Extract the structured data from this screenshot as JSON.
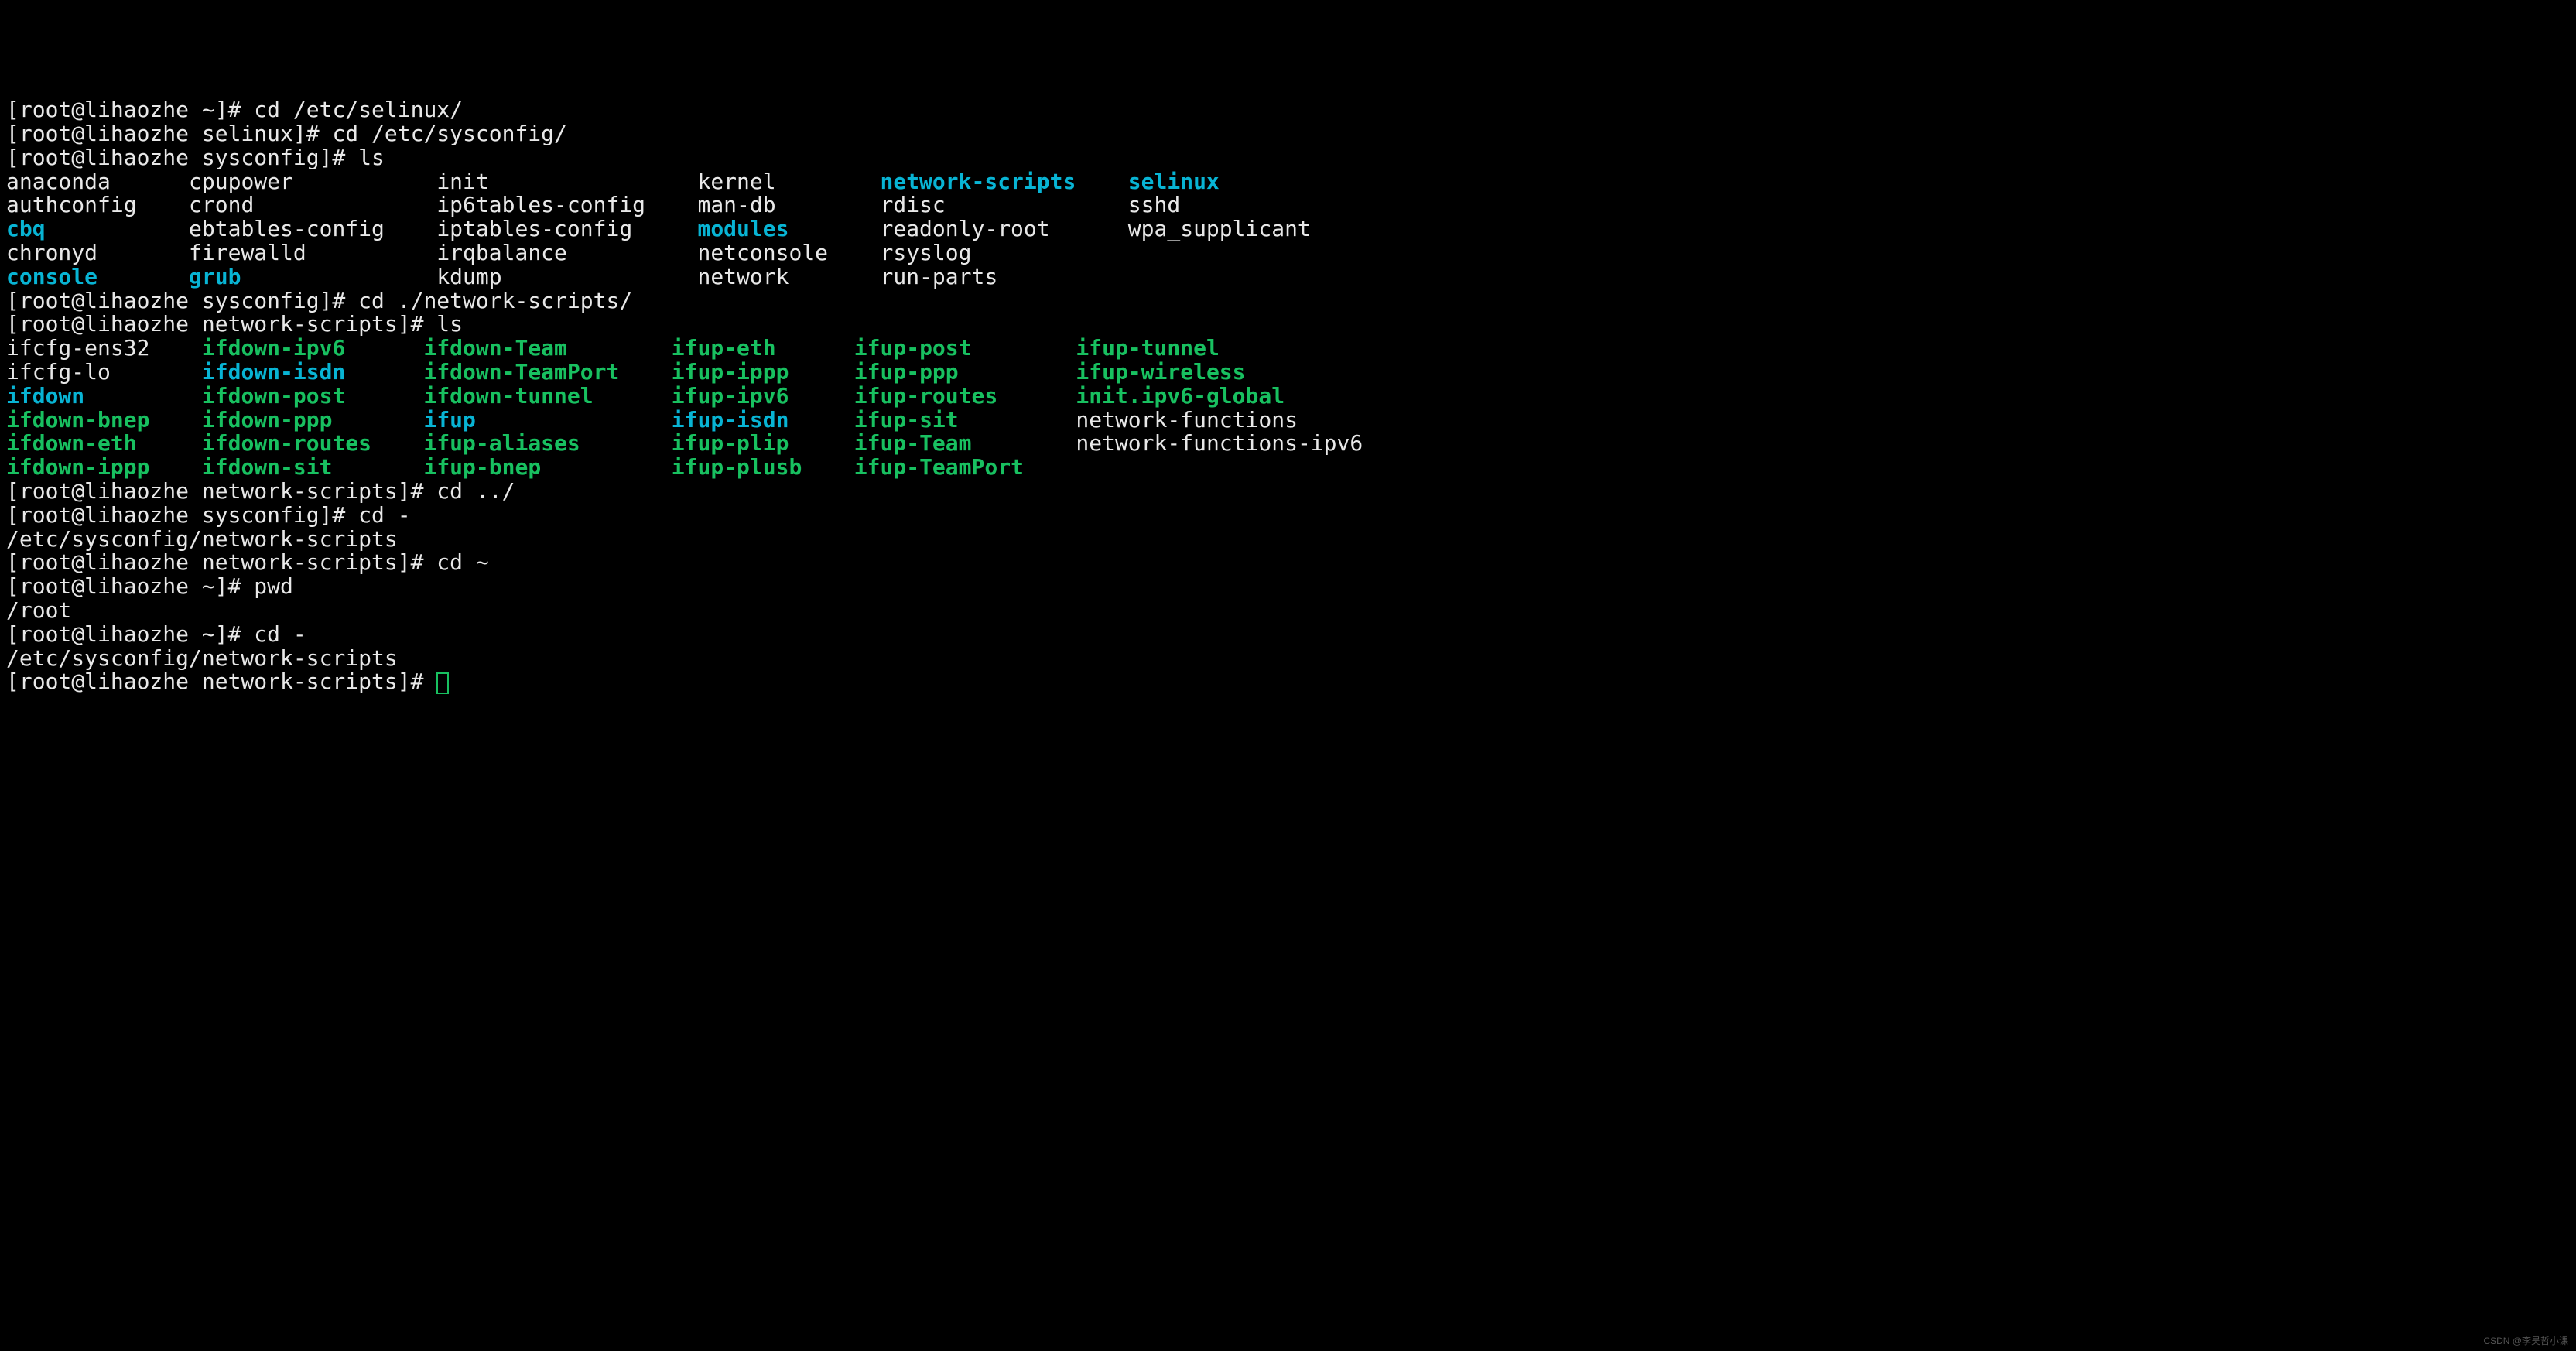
{
  "prompts": {
    "home": "[root@lihaozhe ~]# ",
    "selinux": "[root@lihaozhe selinux]# ",
    "syscfg": "[root@lihaozhe sysconfig]# ",
    "nscr": "[root@lihaozhe network-scripts]# "
  },
  "cmds": {
    "cd_selinux": "cd /etc/selinux/",
    "cd_syscfg": "cd /etc/sysconfig/",
    "ls": "ls",
    "cd_nscr": "cd ./network-scripts/",
    "cd_up": "cd ../",
    "cd_dash": "cd -",
    "cd_home": "cd ~",
    "pwd": "pwd"
  },
  "out": {
    "root_path": "/root",
    "nscr_path": "/etc/sysconfig/network-scripts"
  },
  "ls_sysconfig_cols": [
    [
      {
        "t": "anaconda",
        "c": "w"
      },
      {
        "t": "authconfig",
        "c": "w"
      },
      {
        "t": "cbq",
        "c": "c"
      },
      {
        "t": "chronyd",
        "c": "w"
      },
      {
        "t": "console",
        "c": "c"
      }
    ],
    [
      {
        "t": "cpupower",
        "c": "w"
      },
      {
        "t": "crond",
        "c": "w"
      },
      {
        "t": "ebtables-config",
        "c": "w"
      },
      {
        "t": "firewalld",
        "c": "w"
      },
      {
        "t": "grub",
        "c": "c"
      }
    ],
    [
      {
        "t": "init",
        "c": "w"
      },
      {
        "t": "ip6tables-config",
        "c": "w"
      },
      {
        "t": "iptables-config",
        "c": "w"
      },
      {
        "t": "irqbalance",
        "c": "w"
      },
      {
        "t": "kdump",
        "c": "w"
      }
    ],
    [
      {
        "t": "kernel",
        "c": "w"
      },
      {
        "t": "man-db",
        "c": "w"
      },
      {
        "t": "modules",
        "c": "c"
      },
      {
        "t": "netconsole",
        "c": "w"
      },
      {
        "t": "network",
        "c": "w"
      }
    ],
    [
      {
        "t": "network-scripts",
        "c": "c"
      },
      {
        "t": "rdisc",
        "c": "w"
      },
      {
        "t": "readonly-root",
        "c": "w"
      },
      {
        "t": "rsyslog",
        "c": "w"
      },
      {
        "t": "run-parts",
        "c": "w"
      }
    ],
    [
      {
        "t": "selinux",
        "c": "c"
      },
      {
        "t": "sshd",
        "c": "w"
      },
      {
        "t": "wpa_supplicant",
        "c": "w"
      },
      {
        "t": "",
        "c": "w"
      },
      {
        "t": "",
        "c": "w"
      }
    ]
  ],
  "ls_nscr_cols": [
    [
      {
        "t": "ifcfg-ens32",
        "c": "w"
      },
      {
        "t": "ifcfg-lo",
        "c": "w"
      },
      {
        "t": "ifdown",
        "c": "c"
      },
      {
        "t": "ifdown-bnep",
        "c": "g"
      },
      {
        "t": "ifdown-eth",
        "c": "g"
      },
      {
        "t": "ifdown-ippp",
        "c": "g"
      }
    ],
    [
      {
        "t": "ifdown-ipv6",
        "c": "g"
      },
      {
        "t": "ifdown-isdn",
        "c": "c"
      },
      {
        "t": "ifdown-post",
        "c": "g"
      },
      {
        "t": "ifdown-ppp",
        "c": "g"
      },
      {
        "t": "ifdown-routes",
        "c": "g"
      },
      {
        "t": "ifdown-sit",
        "c": "g"
      }
    ],
    [
      {
        "t": "ifdown-Team",
        "c": "g"
      },
      {
        "t": "ifdown-TeamPort",
        "c": "g"
      },
      {
        "t": "ifdown-tunnel",
        "c": "g"
      },
      {
        "t": "ifup",
        "c": "c"
      },
      {
        "t": "ifup-aliases",
        "c": "g"
      },
      {
        "t": "ifup-bnep",
        "c": "g"
      }
    ],
    [
      {
        "t": "ifup-eth",
        "c": "g"
      },
      {
        "t": "ifup-ippp",
        "c": "g"
      },
      {
        "t": "ifup-ipv6",
        "c": "g"
      },
      {
        "t": "ifup-isdn",
        "c": "c"
      },
      {
        "t": "ifup-plip",
        "c": "g"
      },
      {
        "t": "ifup-plusb",
        "c": "g"
      }
    ],
    [
      {
        "t": "ifup-post",
        "c": "g"
      },
      {
        "t": "ifup-ppp",
        "c": "g"
      },
      {
        "t": "ifup-routes",
        "c": "g"
      },
      {
        "t": "ifup-sit",
        "c": "g"
      },
      {
        "t": "ifup-Team",
        "c": "g"
      },
      {
        "t": "ifup-TeamPort",
        "c": "g"
      }
    ],
    [
      {
        "t": "ifup-tunnel",
        "c": "g"
      },
      {
        "t": "ifup-wireless",
        "c": "g"
      },
      {
        "t": "init.ipv6-global",
        "c": "g"
      },
      {
        "t": "network-functions",
        "c": "w"
      },
      {
        "t": "network-functions-ipv6",
        "c": "w"
      },
      {
        "t": "",
        "c": "w"
      }
    ]
  ],
  "col_widths_sysconfig": [
    12,
    17,
    18,
    12,
    17,
    0
  ],
  "col_widths_nscr": [
    13,
    15,
    17,
    12,
    15,
    0
  ],
  "watermark": "CSDN @李昊哲小课"
}
